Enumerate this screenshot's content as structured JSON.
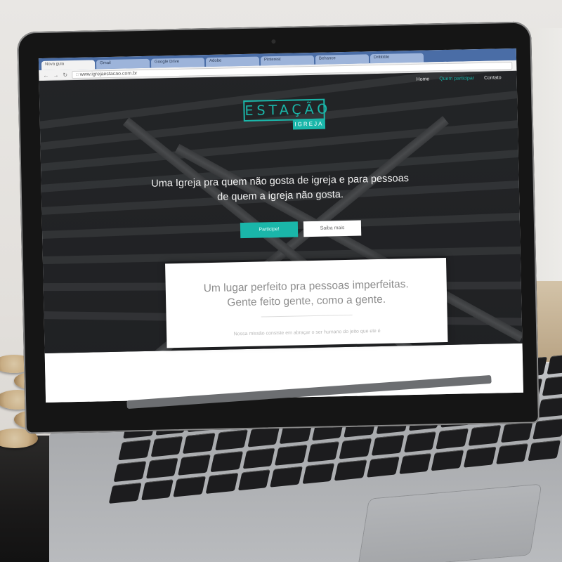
{
  "browser": {
    "tabs": [
      {
        "label": "Nova guia",
        "active": true
      },
      {
        "label": "Gmail",
        "active": false
      },
      {
        "label": "Google Drive",
        "active": false
      },
      {
        "label": "Adobe",
        "active": false
      },
      {
        "label": "Pinterest",
        "active": false
      },
      {
        "label": "Behance",
        "active": false
      },
      {
        "label": "Dribbble",
        "active": false
      }
    ],
    "url": "www.igrejaestacao.com.br",
    "back_icon": "arrow-left-icon",
    "forward_icon": "arrow-right-icon",
    "reload_icon": "reload-icon",
    "globe_icon": "page-icon"
  },
  "site": {
    "nav": {
      "home": "Home",
      "about": "Quem participar",
      "contact": "Contato"
    },
    "logo": {
      "main": "ESTAÇÃO",
      "sub": "IGREJA"
    },
    "tagline": {
      "line1": "Uma Igreja pra quem não gosta de igreja e para pessoas",
      "line2": "de quem a igreja não gosta."
    },
    "buttons": {
      "primary": "Participe!",
      "secondary": "Saiba mais"
    },
    "card": {
      "title_line1": "Um lugar perfeito pra pessoas imperfeitas.",
      "title_line2": "Gente feito gente, como a gente.",
      "text": "Nossa missão consiste em abraçar o ser humano do jeito que ele é"
    }
  },
  "colors": {
    "accent": "#1ab6a9",
    "hero_overlay": "#2a2c2e",
    "tab_bar": "#4a6da6"
  }
}
